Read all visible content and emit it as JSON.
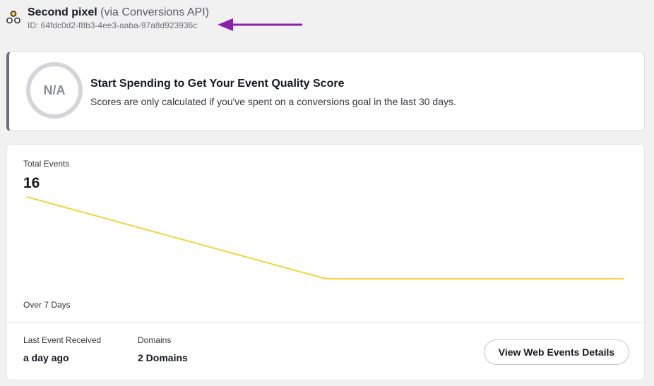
{
  "header": {
    "pixel_name": "Second pixel",
    "pixel_via": "(via Conversions API)",
    "pixel_id": "ID: 64fdc0d2-f8b3-4ee3-aaba-97a8d923936c",
    "icon": "pixel-cluster-icon",
    "annotation_arrow_color": "#8a1fb0"
  },
  "score_card": {
    "score": "N/A",
    "title": "Start Spending to Get Your Event Quality Score",
    "description": "Scores are only calculated if you've spent on a conversions goal in the last 30 days."
  },
  "events_card": {
    "label": "Total Events",
    "total": "16",
    "period": "Over 7 Days",
    "line_color": "#f5d23d",
    "stats": [
      {
        "label": "Last Event Received",
        "value": "a day ago"
      },
      {
        "label": "Domains",
        "value": "2 Domains"
      }
    ],
    "button_label": "View Web Events Details"
  },
  "chart_data": {
    "type": "line",
    "title": "",
    "xlabel": "",
    "ylabel": "",
    "series": [
      {
        "values": [
          16,
          0,
          0
        ]
      }
    ],
    "grid": false
  }
}
